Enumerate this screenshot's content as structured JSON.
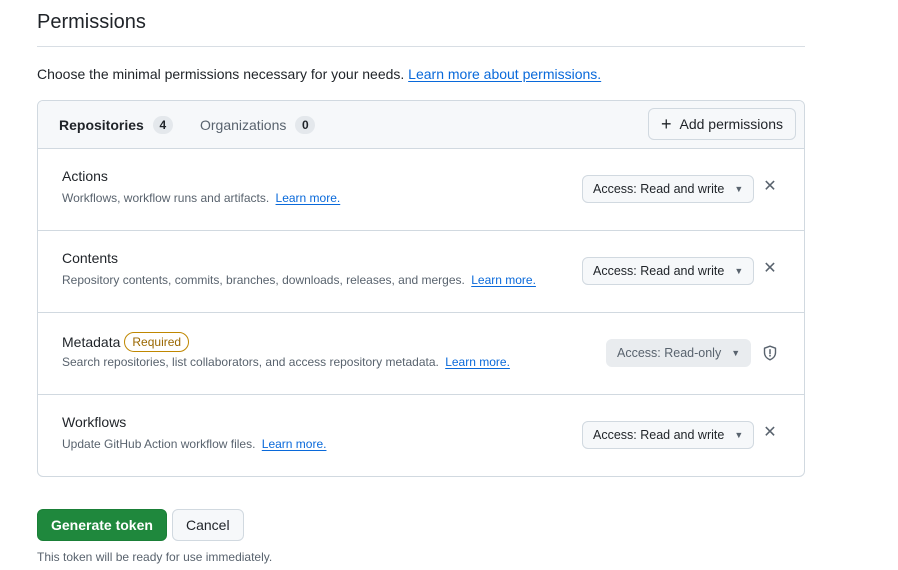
{
  "page": {
    "title": "Permissions",
    "intro_text": "Choose the minimal permissions necessary for your needs.",
    "intro_link": "Learn more about permissions."
  },
  "tabs": [
    {
      "label": "Repositories",
      "count": "4",
      "selected": true
    },
    {
      "label": "Organizations",
      "count": "0",
      "selected": false
    }
  ],
  "add_button": {
    "label": "Add permissions",
    "icon": "plus-icon"
  },
  "permissions": [
    {
      "name": "Actions",
      "description": "Workflows, workflow runs and artifacts.",
      "link": "Learn more.",
      "access": "Access: Read and write",
      "required": false
    },
    {
      "name": "Contents",
      "description": "Repository contents, commits, branches, downloads, releases, and merges.",
      "link": "Learn more.",
      "access": "Access: Read and write",
      "required": false
    },
    {
      "name": "Metadata",
      "badge": "Required",
      "description": "Search repositories, list collaborators, and access repository metadata.",
      "link": "Learn more.",
      "access": "Access: Read-only",
      "required": true
    },
    {
      "name": "Workflows",
      "description": "Update GitHub Action workflow files.",
      "link": "Learn more.",
      "access": "Access: Read and write",
      "required": false
    }
  ],
  "actions": {
    "generate_label": "Generate token",
    "cancel_label": "Cancel",
    "footnote": "This token will be ready for use immediately."
  },
  "colors": {
    "primary_green": "#1f883d",
    "link_blue": "#0969da",
    "required_badge": "#9a6700"
  }
}
